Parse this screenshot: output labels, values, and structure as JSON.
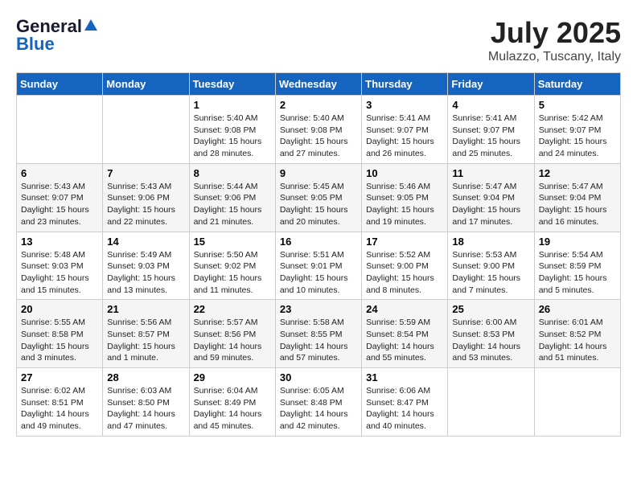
{
  "header": {
    "logo_general": "General",
    "logo_blue": "Blue",
    "month_title": "July 2025",
    "location": "Mulazzo, Tuscany, Italy"
  },
  "weekdays": [
    "Sunday",
    "Monday",
    "Tuesday",
    "Wednesday",
    "Thursday",
    "Friday",
    "Saturday"
  ],
  "weeks": [
    [
      {
        "day": "",
        "info": ""
      },
      {
        "day": "",
        "info": ""
      },
      {
        "day": "1",
        "info": "Sunrise: 5:40 AM\nSunset: 9:08 PM\nDaylight: 15 hours and 28 minutes."
      },
      {
        "day": "2",
        "info": "Sunrise: 5:40 AM\nSunset: 9:08 PM\nDaylight: 15 hours and 27 minutes."
      },
      {
        "day": "3",
        "info": "Sunrise: 5:41 AM\nSunset: 9:07 PM\nDaylight: 15 hours and 26 minutes."
      },
      {
        "day": "4",
        "info": "Sunrise: 5:41 AM\nSunset: 9:07 PM\nDaylight: 15 hours and 25 minutes."
      },
      {
        "day": "5",
        "info": "Sunrise: 5:42 AM\nSunset: 9:07 PM\nDaylight: 15 hours and 24 minutes."
      }
    ],
    [
      {
        "day": "6",
        "info": "Sunrise: 5:43 AM\nSunset: 9:07 PM\nDaylight: 15 hours and 23 minutes."
      },
      {
        "day": "7",
        "info": "Sunrise: 5:43 AM\nSunset: 9:06 PM\nDaylight: 15 hours and 22 minutes."
      },
      {
        "day": "8",
        "info": "Sunrise: 5:44 AM\nSunset: 9:06 PM\nDaylight: 15 hours and 21 minutes."
      },
      {
        "day": "9",
        "info": "Sunrise: 5:45 AM\nSunset: 9:05 PM\nDaylight: 15 hours and 20 minutes."
      },
      {
        "day": "10",
        "info": "Sunrise: 5:46 AM\nSunset: 9:05 PM\nDaylight: 15 hours and 19 minutes."
      },
      {
        "day": "11",
        "info": "Sunrise: 5:47 AM\nSunset: 9:04 PM\nDaylight: 15 hours and 17 minutes."
      },
      {
        "day": "12",
        "info": "Sunrise: 5:47 AM\nSunset: 9:04 PM\nDaylight: 15 hours and 16 minutes."
      }
    ],
    [
      {
        "day": "13",
        "info": "Sunrise: 5:48 AM\nSunset: 9:03 PM\nDaylight: 15 hours and 15 minutes."
      },
      {
        "day": "14",
        "info": "Sunrise: 5:49 AM\nSunset: 9:03 PM\nDaylight: 15 hours and 13 minutes."
      },
      {
        "day": "15",
        "info": "Sunrise: 5:50 AM\nSunset: 9:02 PM\nDaylight: 15 hours and 11 minutes."
      },
      {
        "day": "16",
        "info": "Sunrise: 5:51 AM\nSunset: 9:01 PM\nDaylight: 15 hours and 10 minutes."
      },
      {
        "day": "17",
        "info": "Sunrise: 5:52 AM\nSunset: 9:00 PM\nDaylight: 15 hours and 8 minutes."
      },
      {
        "day": "18",
        "info": "Sunrise: 5:53 AM\nSunset: 9:00 PM\nDaylight: 15 hours and 7 minutes."
      },
      {
        "day": "19",
        "info": "Sunrise: 5:54 AM\nSunset: 8:59 PM\nDaylight: 15 hours and 5 minutes."
      }
    ],
    [
      {
        "day": "20",
        "info": "Sunrise: 5:55 AM\nSunset: 8:58 PM\nDaylight: 15 hours and 3 minutes."
      },
      {
        "day": "21",
        "info": "Sunrise: 5:56 AM\nSunset: 8:57 PM\nDaylight: 15 hours and 1 minute."
      },
      {
        "day": "22",
        "info": "Sunrise: 5:57 AM\nSunset: 8:56 PM\nDaylight: 14 hours and 59 minutes."
      },
      {
        "day": "23",
        "info": "Sunrise: 5:58 AM\nSunset: 8:55 PM\nDaylight: 14 hours and 57 minutes."
      },
      {
        "day": "24",
        "info": "Sunrise: 5:59 AM\nSunset: 8:54 PM\nDaylight: 14 hours and 55 minutes."
      },
      {
        "day": "25",
        "info": "Sunrise: 6:00 AM\nSunset: 8:53 PM\nDaylight: 14 hours and 53 minutes."
      },
      {
        "day": "26",
        "info": "Sunrise: 6:01 AM\nSunset: 8:52 PM\nDaylight: 14 hours and 51 minutes."
      }
    ],
    [
      {
        "day": "27",
        "info": "Sunrise: 6:02 AM\nSunset: 8:51 PM\nDaylight: 14 hours and 49 minutes."
      },
      {
        "day": "28",
        "info": "Sunrise: 6:03 AM\nSunset: 8:50 PM\nDaylight: 14 hours and 47 minutes."
      },
      {
        "day": "29",
        "info": "Sunrise: 6:04 AM\nSunset: 8:49 PM\nDaylight: 14 hours and 45 minutes."
      },
      {
        "day": "30",
        "info": "Sunrise: 6:05 AM\nSunset: 8:48 PM\nDaylight: 14 hours and 42 minutes."
      },
      {
        "day": "31",
        "info": "Sunrise: 6:06 AM\nSunset: 8:47 PM\nDaylight: 14 hours and 40 minutes."
      },
      {
        "day": "",
        "info": ""
      },
      {
        "day": "",
        "info": ""
      }
    ]
  ]
}
